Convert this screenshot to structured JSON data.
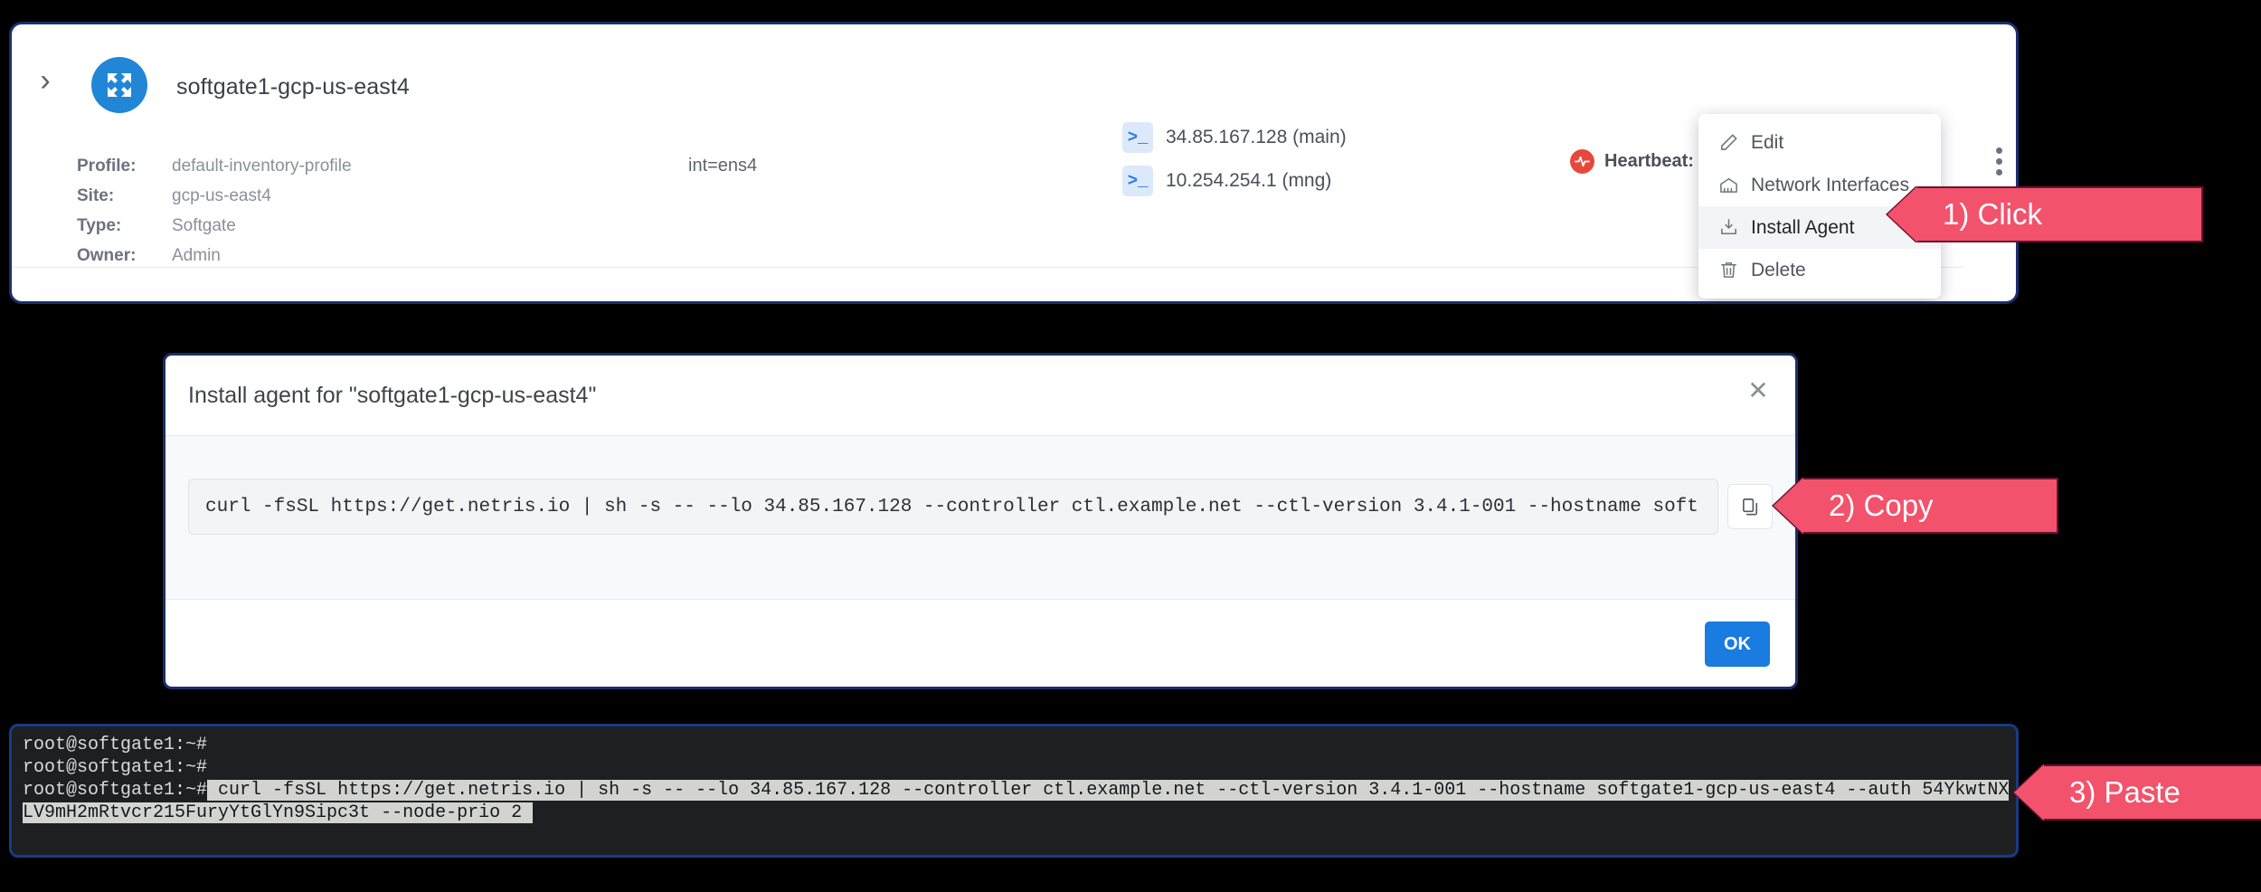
{
  "device": {
    "name": "softgate1-gcp-us-east4",
    "expand_icon": "chevron-right-icon",
    "device_icon": "softgate-arrows-icon",
    "meta": [
      {
        "key": "Profile:",
        "value": "default-inventory-profile"
      },
      {
        "key": "Site:",
        "value": "gcp-us-east4"
      },
      {
        "key": "Type:",
        "value": "Softgate"
      },
      {
        "key": "Owner:",
        "value": "Admin"
      }
    ],
    "interface": "int=ens4",
    "addresses": [
      {
        "icon": ">_",
        "text": "34.85.167.128 (main)"
      },
      {
        "icon": ">_",
        "text": "10.254.254.1 (mng)"
      }
    ],
    "heartbeat_label": "Heartbeat:",
    "heartbeat_icon": "heartbeat-pulse-icon",
    "kebab_icon": "more-vertical-icon"
  },
  "context_menu": {
    "items": [
      {
        "label": "Edit",
        "icon": "pencil-icon",
        "active": false
      },
      {
        "label": "Network Interfaces",
        "icon": "network-interfaces-icon",
        "active": false
      },
      {
        "label": "Install Agent",
        "icon": "download-install-icon",
        "active": true
      },
      {
        "label": "Delete",
        "icon": "trash-icon",
        "active": false
      }
    ]
  },
  "modal": {
    "title": "Install agent for \"softgate1-gcp-us-east4\"",
    "close_icon": "close-icon",
    "command": "curl -fsSL https://get.netris.io | sh -s -- --lo 34.85.167.128 --controller ctl.example.net --ctl-version 3.4.1-001 --hostname soft",
    "copy_icon": "copy-icon",
    "ok_label": "OK"
  },
  "terminal": {
    "lines": [
      {
        "prompt": "root@softgate1:~#",
        "selected": ""
      },
      {
        "prompt": "root@softgate1:~#",
        "selected": ""
      },
      {
        "prompt": "root@softgate1:~#",
        "selected": " curl -fsSL https://get.netris.io | sh -s -- --lo 34.85.167.128 --controller ctl.example.net --ctl-version 3.4.1-001 --hostname softgate1-gcp-us-east4 --auth 54YkwtNX"
      },
      {
        "prompt": "",
        "selected": "LV9mH2mRtvcr215FuryYtGlYn9Sipc3t --node-prio 2 "
      }
    ]
  },
  "callouts": {
    "click": "1) Click",
    "copy": "2) Copy",
    "paste": "3) Paste"
  },
  "colors": {
    "accent_blue": "#1a7be0",
    "callout_pink": "#f2526b",
    "callout_border": "#6c1030",
    "panel_border": "#1a2f6e",
    "heartbeat_red": "#e8483c"
  }
}
